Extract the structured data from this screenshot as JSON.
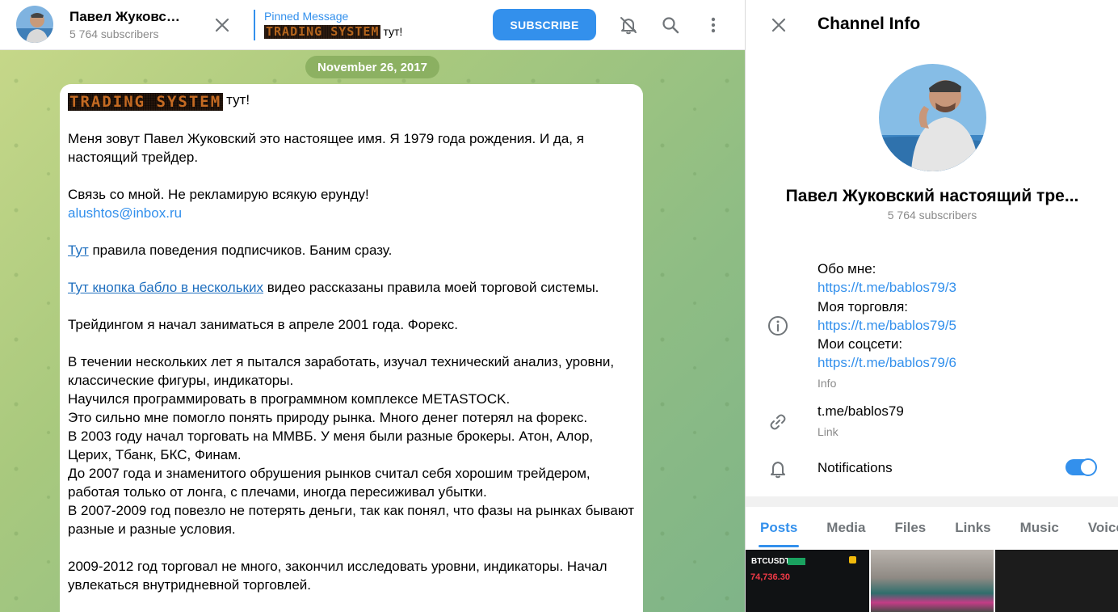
{
  "chat_header": {
    "title": "Павел Жуковский настоящий трейдер",
    "subscribers": "5 764 subscribers",
    "pinned_label": "Pinned Message",
    "pinned_logo_text": "TRADING SYSTEM",
    "pinned_text": "тут!",
    "subscribe_label": "SUBSCRIBE"
  },
  "date_label": "November 26, 2017",
  "message": {
    "logo_text": "TRADING SYSTEM",
    "logo_suffix": "тут!",
    "p1": "Меня зовут Павел Жуковский это настоящее имя. Я 1979 года рождения. И да, я настоящий трейдер.",
    "p2": "Связь со мной. Не рекламирую всякую ерунду!",
    "email": "alushtos@inbox.ru",
    "link1": "Тут",
    "link1_rest": " правила поведения подписчиков. Баним сразу.",
    "link2": "Тут кнопка бабло в нескольких",
    "link2_rest": " видео рассказаны правила моей торговой системы.",
    "p3": "Трейдингом я начал заниматься в апреле 2001 года. Форекс.",
    "p4": "В течении нескольких лет я пытался заработать, изучал технический анализ, уровни, классические фигуры, индикаторы.",
    "p5": "Научился программировать в программном комплексе METASTOCK.",
    "p6": "Это сильно мне помогло понять природу рынка. Много денег потерял на форекс.",
    "p7": "В 2003 году начал торговать на ММВБ. У меня были разные брокеры. Атон, Алор, Церих, Тбанк, БКС, Финам.",
    "p8": "До 2007 года и знаменитого обрушения рынков считал себя хорошим трейдером, работая только от лонга, с плечами, иногда пересиживал убытки.",
    "p9": "В 2007-2009 год повезло не потерять деньги, так как понял, что фазы на рынках бывают разные и разные условия.",
    "p10": "2009-2012 год торговал не много, закончил исследовать уровни, индикаторы. Начал увлекаться внутридневной торговлей."
  },
  "panel": {
    "title": "Channel Info",
    "name": "Павел Жуковский настоящий тре...",
    "subscribers": "5 764 subscribers",
    "info": {
      "about_label": "Обо мне:",
      "about_link": "https://t.me/bablos79/3",
      "trading_label": "Моя торговля:",
      "trading_link": "https://t.me/bablos79/5",
      "social_label": "Мои соцсети:",
      "social_link": "https://t.me/bablos79/6",
      "caption": "Info"
    },
    "link": {
      "value": "t.me/bablos79",
      "caption": "Link"
    },
    "notifications": {
      "label": "Notifications",
      "enabled": true
    },
    "tabs": [
      "Posts",
      "Media",
      "Files",
      "Links",
      "Music",
      "Voice"
    ],
    "thumb1": {
      "ticker": "BTCUSDT",
      "price": "74,736.30"
    }
  },
  "colors": {
    "accent": "#3390ec",
    "chat_bg": "#a9c97e",
    "date_pill": "#81a858"
  }
}
